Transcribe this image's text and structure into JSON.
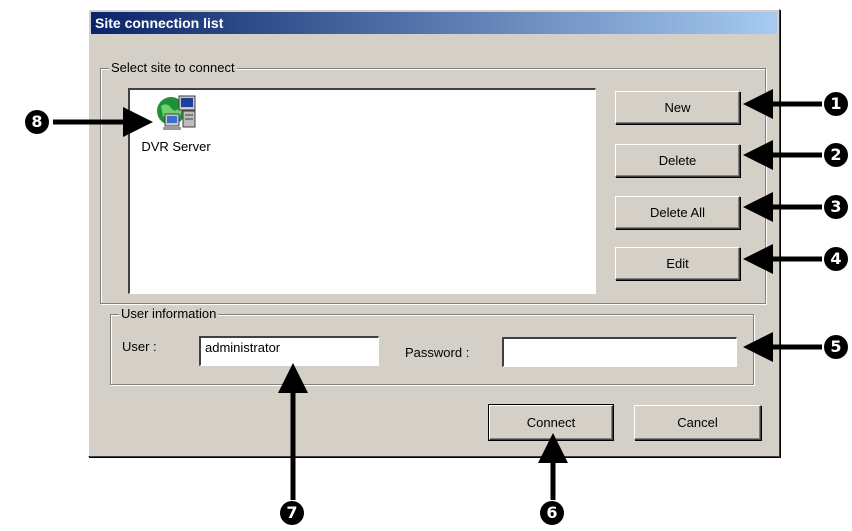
{
  "window": {
    "title": "Site connection list"
  },
  "site_group": {
    "legend": "Select site to connect",
    "items": [
      {
        "label": "DVR Server",
        "icon": "networked-computer-globe-icon"
      }
    ]
  },
  "buttons": {
    "new": "New",
    "delete": "Delete",
    "delete_all": "Delete All",
    "edit": "Edit",
    "connect": "Connect",
    "cancel": "Cancel"
  },
  "user_group": {
    "legend": "User information",
    "user_label": "User :",
    "user_value": "administrator",
    "password_label": "Password :",
    "password_value": ""
  },
  "callouts": [
    "1",
    "2",
    "3",
    "4",
    "5",
    "6",
    "7",
    "8"
  ]
}
